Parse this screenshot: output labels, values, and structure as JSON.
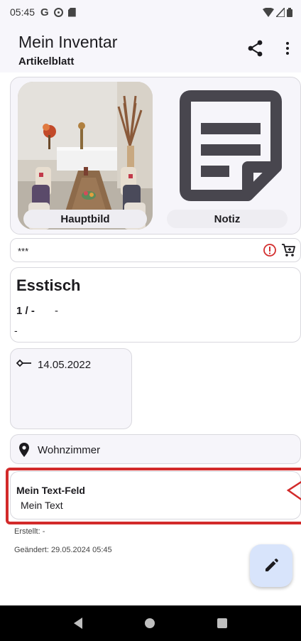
{
  "status_bar": {
    "time": "05:45"
  },
  "app_bar": {
    "title": "Mein Inventar",
    "subtitle": "Artikelblatt"
  },
  "images": {
    "main_label": "Hauptbild",
    "note_label": "Notiz"
  },
  "code_row": {
    "value": "***"
  },
  "item": {
    "title": "Esstisch",
    "quantity": "1 / -",
    "quantity_extra": "-",
    "description": "-"
  },
  "date": {
    "value": "14.05.2022"
  },
  "location": {
    "value": "Wohnzimmer"
  },
  "custom_field": {
    "label": "Mein Text-Feld",
    "value": "Mein Text"
  },
  "meta": {
    "created": "Erstellt: -",
    "changed": "Geändert: 29.05.2024 05:45"
  },
  "colors": {
    "highlight": "#d22a2a",
    "alert": "#d32f2f",
    "fab": "#d8e4fb"
  }
}
